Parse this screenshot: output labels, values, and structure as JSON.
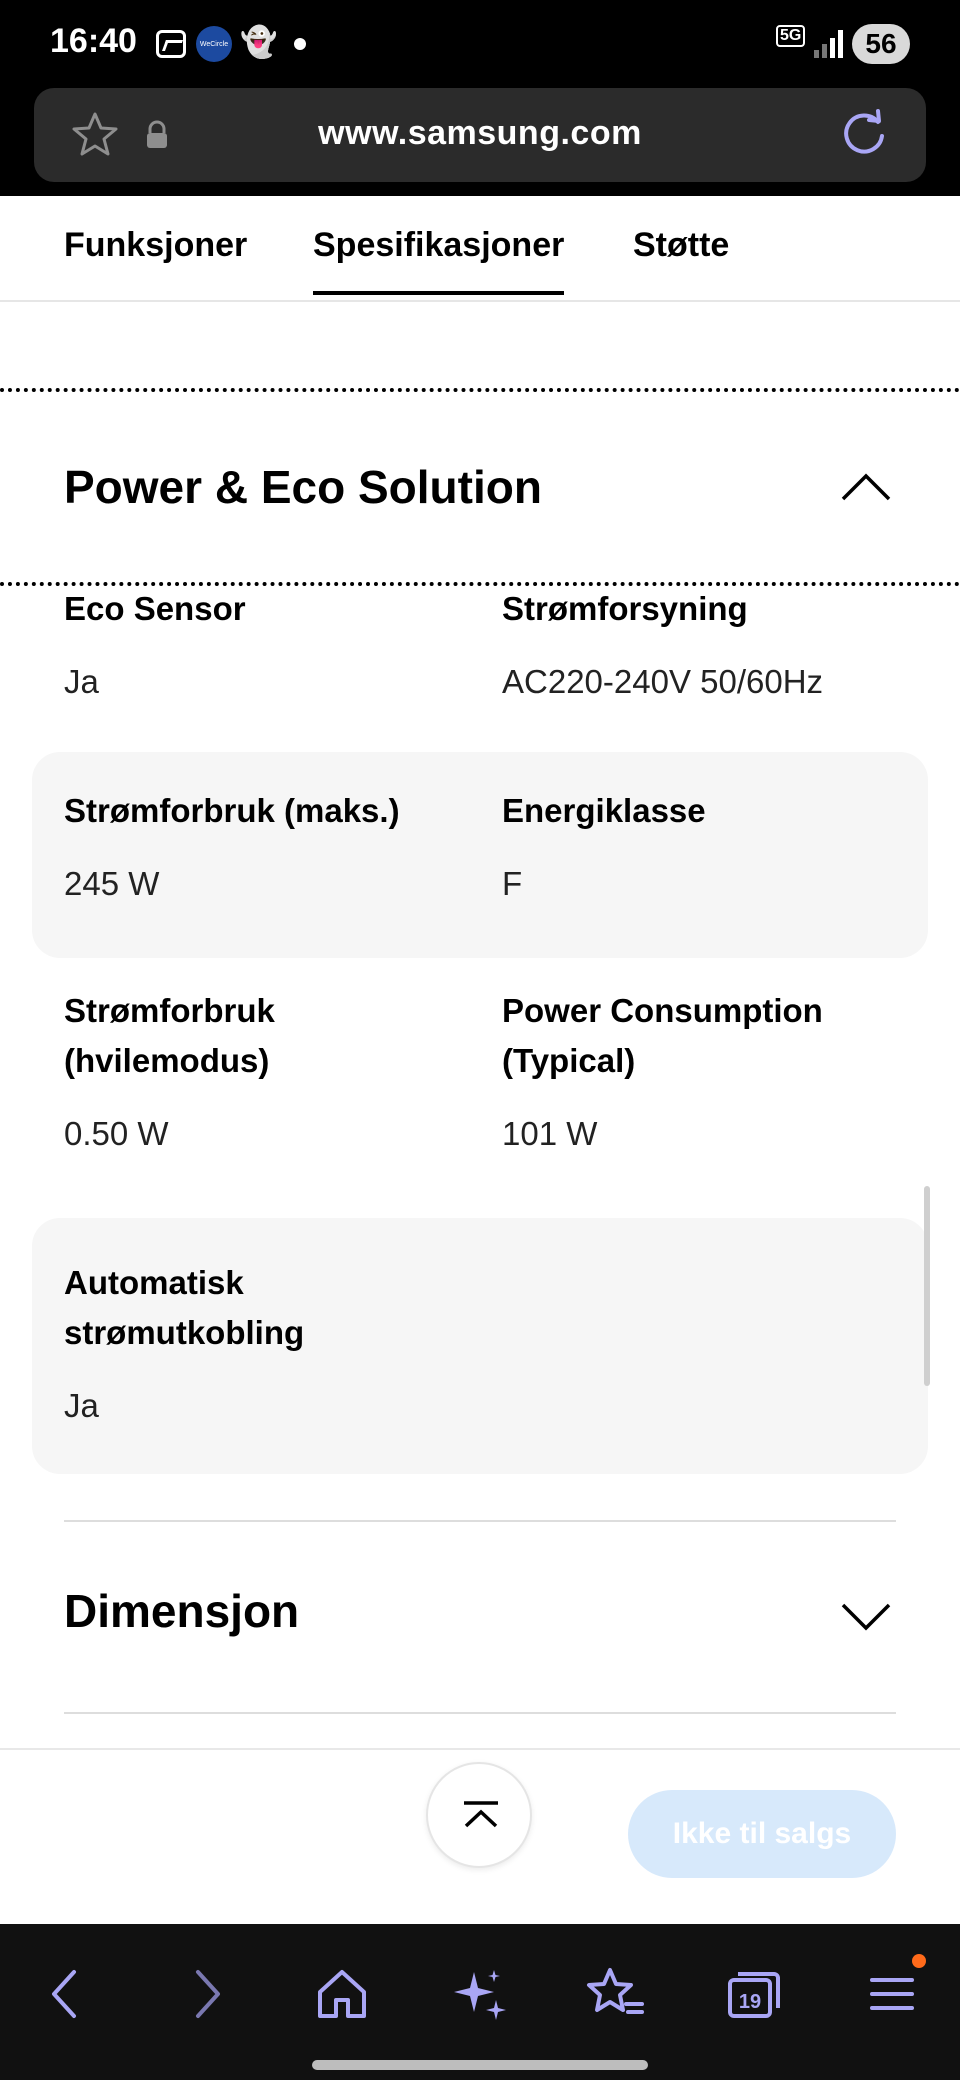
{
  "status_bar": {
    "time": "16:40",
    "wecircle_label": "WeCircle",
    "network": "5G",
    "battery": "56"
  },
  "browser": {
    "url": "www.samsung.com",
    "tab_count": "19"
  },
  "tabs": [
    {
      "label": "Funksjoner",
      "active": false
    },
    {
      "label": "Spesifikasjoner",
      "active": true
    },
    {
      "label": "Støtte",
      "active": false
    }
  ],
  "section": {
    "title": "Power & Eco Solution",
    "expanded": true,
    "rows": [
      {
        "shaded": false,
        "cells": [
          {
            "label": "Eco Sensor",
            "value": "Ja"
          },
          {
            "label": "Strømforsyning",
            "value": "AC220-240V 50/60Hz"
          }
        ]
      },
      {
        "shaded": true,
        "cells": [
          {
            "label": "Strømforbruk (maks.)",
            "value": "245 W"
          },
          {
            "label": "Energiklasse",
            "value": "F"
          }
        ]
      },
      {
        "shaded": false,
        "cells": [
          {
            "label_line1": "Strømforbruk",
            "label_line2": "(hvilemodus)",
            "value": "0.50 W"
          },
          {
            "label_line1": "Power Consumption",
            "label_line2": "(Typical)",
            "value": "101 W"
          }
        ]
      },
      {
        "shaded": true,
        "cells": [
          {
            "label_line1": "Automatisk",
            "label_line2": "strømutkobling",
            "value": "Ja"
          }
        ]
      }
    ]
  },
  "collapsed_section": {
    "title": "Dimensjon",
    "expanded": false
  },
  "action": {
    "buy_label": "Ikke til salgs"
  },
  "colors": {
    "buy_button_bg": "#d7e9fb",
    "nav_icon": "#a9a6f5",
    "notification_dot": "#ff6a1a"
  }
}
